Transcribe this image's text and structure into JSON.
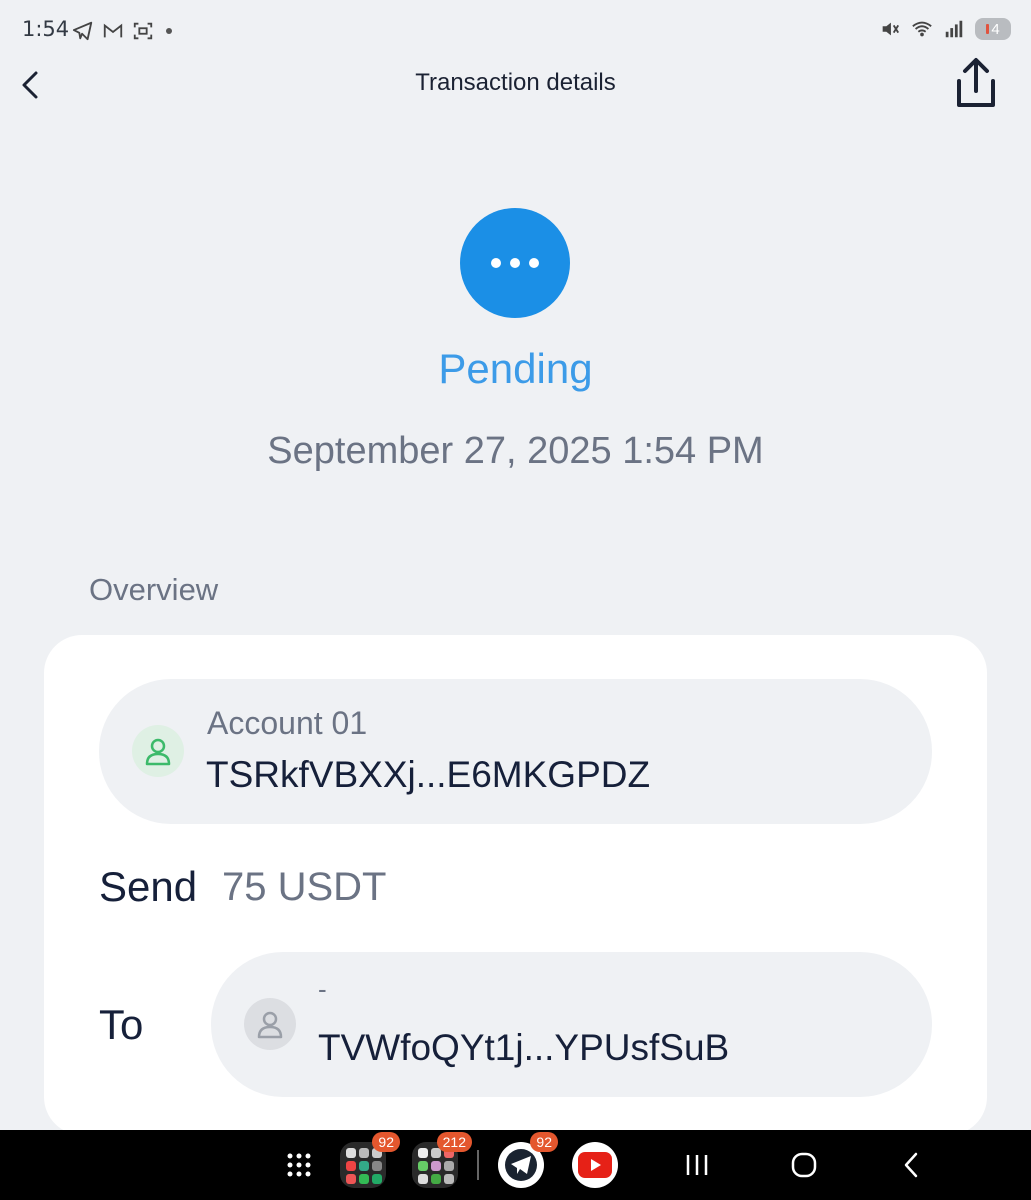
{
  "status_bar": {
    "time": "1:54",
    "battery_level": "4",
    "icons": [
      "telegram-icon",
      "gmail-icon",
      "screenshot-icon",
      "mute-icon",
      "wifi-icon",
      "signal-icon"
    ]
  },
  "header": {
    "title": "Transaction details",
    "back_icon": "chevron-left-icon",
    "share_icon": "share-icon"
  },
  "transaction": {
    "status": "Pending",
    "status_color": "#1b8fe6",
    "date": "September 27, 2025 1:54 PM"
  },
  "overview": {
    "section_label": "Overview",
    "from": {
      "name": "Account 01",
      "address": "TSRkfVBXXj...E6MKGPDZ"
    },
    "send_label": "Send",
    "amount": "75 USDT",
    "to_label": "To",
    "to": {
      "name": "-",
      "address": "TVWfoQYt1j...YPUsfSuB"
    }
  },
  "navbar": {
    "apps": [
      {
        "name": "app-folder-1",
        "badge": "92"
      },
      {
        "name": "app-folder-2",
        "badge": "212"
      },
      {
        "name": "telegram-app",
        "badge": "92"
      },
      {
        "name": "youtube-app",
        "badge": ""
      }
    ]
  }
}
